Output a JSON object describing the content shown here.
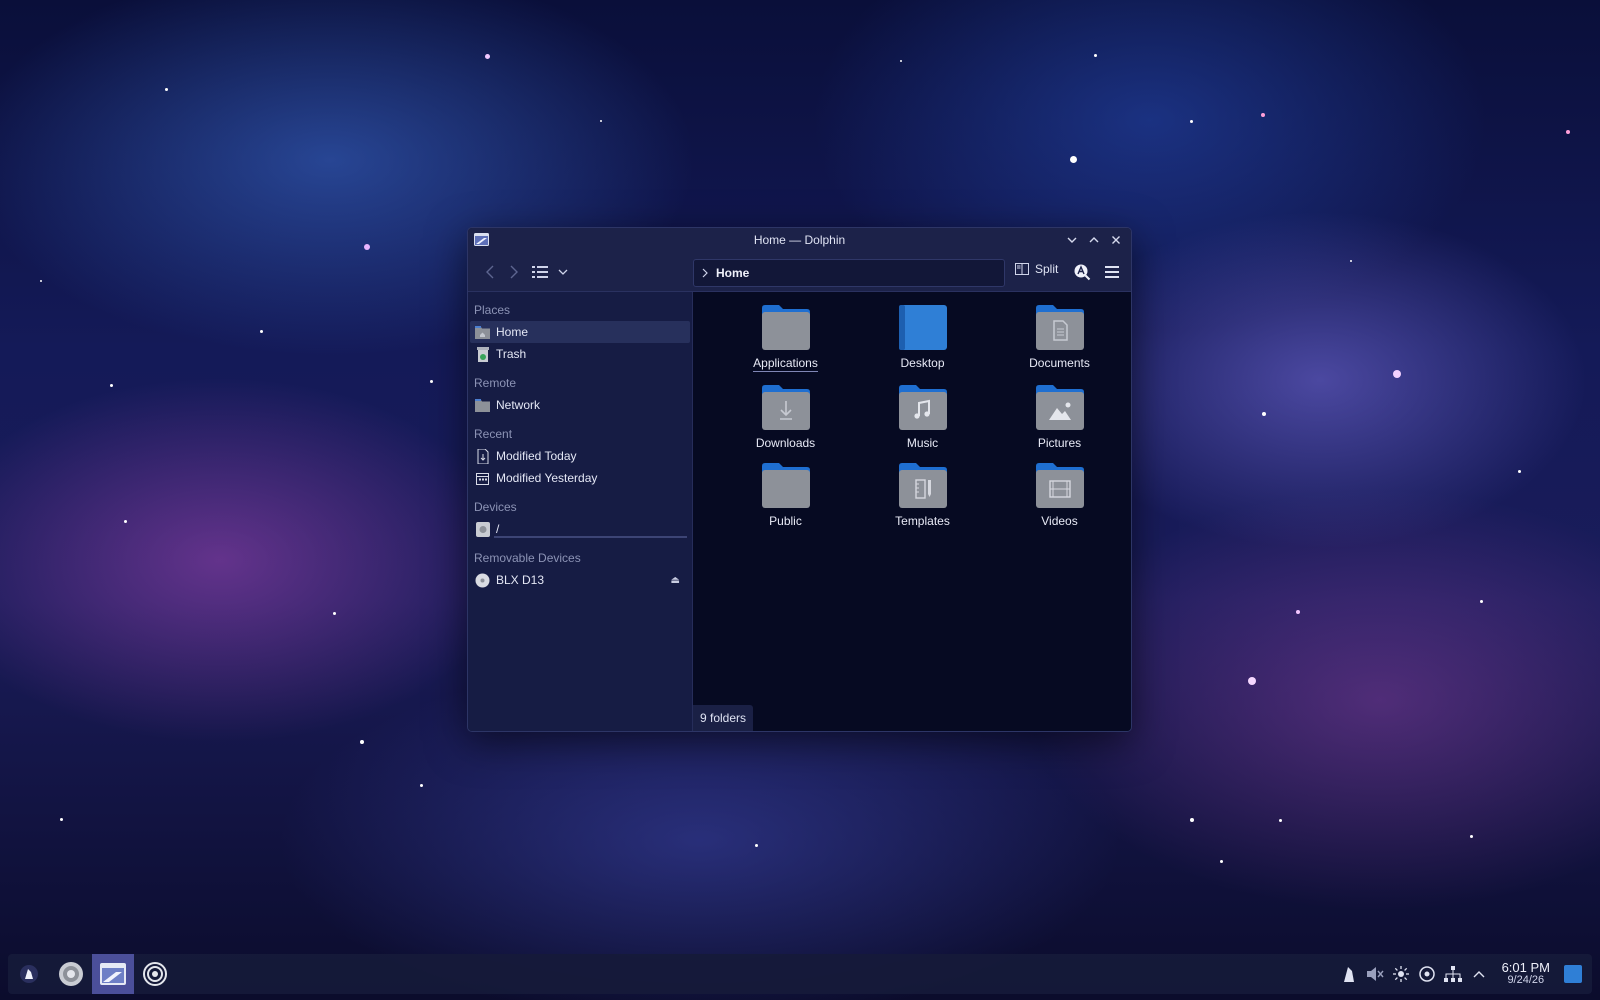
{
  "window": {
    "title": "Home — Dolphin"
  },
  "toolbar": {
    "breadcrumb": "Home",
    "split_label": "Split"
  },
  "sidebar": {
    "places_header": "Places",
    "places": [
      {
        "label": "Home",
        "icon": "home-folder-icon",
        "active": true
      },
      {
        "label": "Trash",
        "icon": "trash-icon"
      }
    ],
    "remote_header": "Remote",
    "remote": [
      {
        "label": "Network",
        "icon": "network-folder-icon"
      }
    ],
    "recent_header": "Recent",
    "recent": [
      {
        "label": "Modified Today",
        "icon": "modified-today-icon"
      },
      {
        "label": "Modified Yesterday",
        "icon": "calendar-icon"
      }
    ],
    "devices_header": "Devices",
    "devices": [
      {
        "label": "/",
        "icon": "drive-icon"
      }
    ],
    "removable_header": "Removable Devices",
    "removable": [
      {
        "label": "BLX D13",
        "icon": "disc-icon"
      }
    ]
  },
  "content": {
    "folders": [
      {
        "label": "Applications",
        "icon": "folder-icon"
      },
      {
        "label": "Desktop",
        "icon": "desktop-folder-icon"
      },
      {
        "label": "Documents",
        "icon": "documents-folder-icon"
      },
      {
        "label": "Downloads",
        "icon": "downloads-folder-icon"
      },
      {
        "label": "Music",
        "icon": "music-folder-icon"
      },
      {
        "label": "Pictures",
        "icon": "pictures-folder-icon"
      },
      {
        "label": "Public",
        "icon": "folder-icon"
      },
      {
        "label": "Templates",
        "icon": "templates-folder-icon"
      },
      {
        "label": "Videos",
        "icon": "videos-folder-icon"
      }
    ],
    "status": "9 folders"
  },
  "taskbar": {
    "time": "6:01 PM",
    "date": "9/24/26"
  },
  "colors": {
    "accent": "#2f7fd6",
    "folder_tab": "#1f6fd1",
    "folder_body": "#8d9199"
  }
}
